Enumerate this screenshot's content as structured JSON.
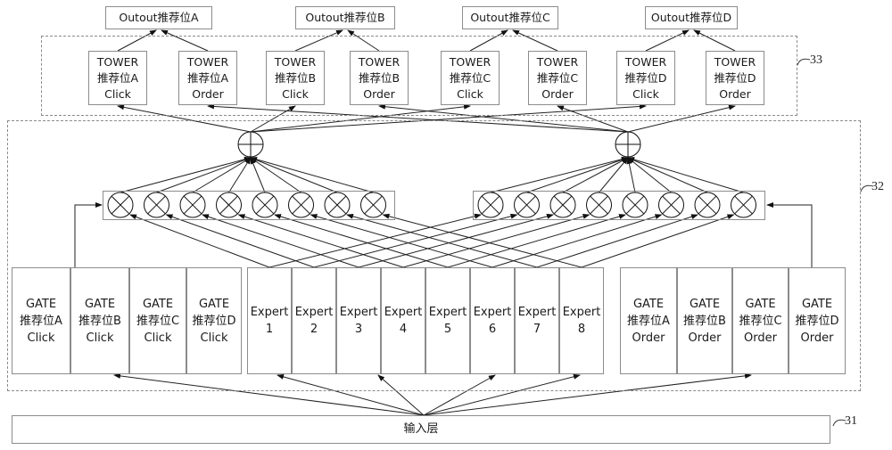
{
  "outputs": [
    {
      "label": "Outout推荐位A"
    },
    {
      "label": "Outout推荐位B"
    },
    {
      "label": "Outout推荐位C"
    },
    {
      "label": "Outout推荐位D"
    }
  ],
  "towers": [
    {
      "l1": "TOWER",
      "l2": "推荐位A",
      "l3": "Click"
    },
    {
      "l1": "TOWER",
      "l2": "推荐位A",
      "l3": "Order"
    },
    {
      "l1": "TOWER",
      "l2": "推荐位B",
      "l3": "Click"
    },
    {
      "l1": "TOWER",
      "l2": "推荐位B",
      "l3": "Order"
    },
    {
      "l1": "TOWER",
      "l2": "推荐位C",
      "l3": "Click"
    },
    {
      "l1": "TOWER",
      "l2": "推荐位C",
      "l3": "Order"
    },
    {
      "l1": "TOWER",
      "l2": "推荐位D",
      "l3": "Click"
    },
    {
      "l1": "TOWER",
      "l2": "推荐位D",
      "l3": "Order"
    }
  ],
  "gates_click": [
    {
      "l1": "GATE",
      "l2": "推荐位A",
      "l3": "Click"
    },
    {
      "l1": "GATE",
      "l2": "推荐位B",
      "l3": "Click"
    },
    {
      "l1": "GATE",
      "l2": "推荐位C",
      "l3": "Click"
    },
    {
      "l1": "GATE",
      "l2": "推荐位D",
      "l3": "Click"
    }
  ],
  "experts": [
    {
      "l1": "Expert",
      "l2": "1"
    },
    {
      "l1": "Expert",
      "l2": "2"
    },
    {
      "l1": "Expert",
      "l2": "3"
    },
    {
      "l1": "Expert",
      "l2": "4"
    },
    {
      "l1": "Expert",
      "l2": "5"
    },
    {
      "l1": "Expert",
      "l2": "6"
    },
    {
      "l1": "Expert",
      "l2": "7"
    },
    {
      "l1": "Expert",
      "l2": "8"
    }
  ],
  "gates_order": [
    {
      "l1": "GATE",
      "l2": "推荐位A",
      "l3": "Order"
    },
    {
      "l1": "GATE",
      "l2": "推荐位B",
      "l3": "Order"
    },
    {
      "l1": "GATE",
      "l2": "推荐位C",
      "l3": "Order"
    },
    {
      "l1": "GATE",
      "l2": "推荐位D",
      "l3": "Order"
    }
  ],
  "input_layer": {
    "label": "输入层"
  },
  "refs": {
    "tower_group": "33",
    "moe_group": "32",
    "input": "31"
  },
  "multiplier_count_per_group": 8
}
